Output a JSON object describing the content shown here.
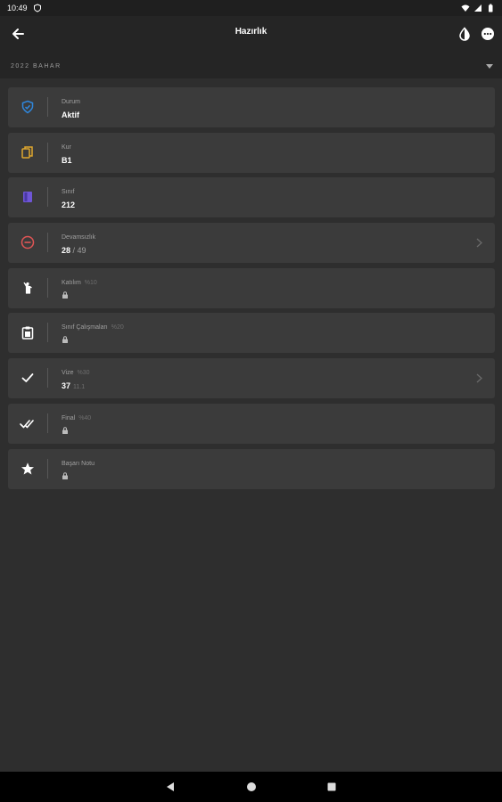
{
  "status_bar": {
    "time": "10:49",
    "icons": [
      "shield-icon",
      "wifi-icon",
      "signal-icon",
      "battery-icon"
    ]
  },
  "app_bar": {
    "title": "Hazırlık",
    "back_icon": "arrow-left-icon",
    "actions": [
      "theme-toggle-icon",
      "more-options-icon"
    ]
  },
  "semester": {
    "label": "2022 BAHAR"
  },
  "cards": [
    {
      "id": "durum",
      "icon": "shield-check-icon",
      "label": "Durum",
      "value": "Aktif",
      "color": "#2f87dd"
    },
    {
      "id": "kur",
      "icon": "books-icon",
      "label": "Kur",
      "value": "B1",
      "color": "#e0a82e"
    },
    {
      "id": "sinif",
      "icon": "book-icon",
      "label": "Sınıf",
      "value": "212",
      "color": "#6f56d6"
    },
    {
      "id": "devamsizlik",
      "icon": "minus-circle-icon",
      "label": "Devamsızlık",
      "value": "28",
      "value_suffix": "/ 49",
      "color": "#e05555"
    },
    {
      "id": "katilim",
      "icon": "person-raised-hand-icon",
      "label": "Katılım",
      "weight": "%10"
    },
    {
      "id": "sinif-calismalari",
      "icon": "clipboard-icon",
      "label": "Sınıf Çalışmaları",
      "weight": "%20"
    },
    {
      "id": "vize",
      "icon": "check-icon",
      "label": "Vize",
      "weight": "%30",
      "value": "37",
      "value_extra": "11.1"
    },
    {
      "id": "final",
      "icon": "double-check-icon",
      "label": "Final",
      "weight": "%40"
    },
    {
      "id": "basari-notu",
      "icon": "star-icon",
      "label": "Başarı Notu"
    }
  ],
  "colors": {
    "background": "#2e2e2e",
    "card": "#3b3b3b",
    "bar": "#252525"
  }
}
